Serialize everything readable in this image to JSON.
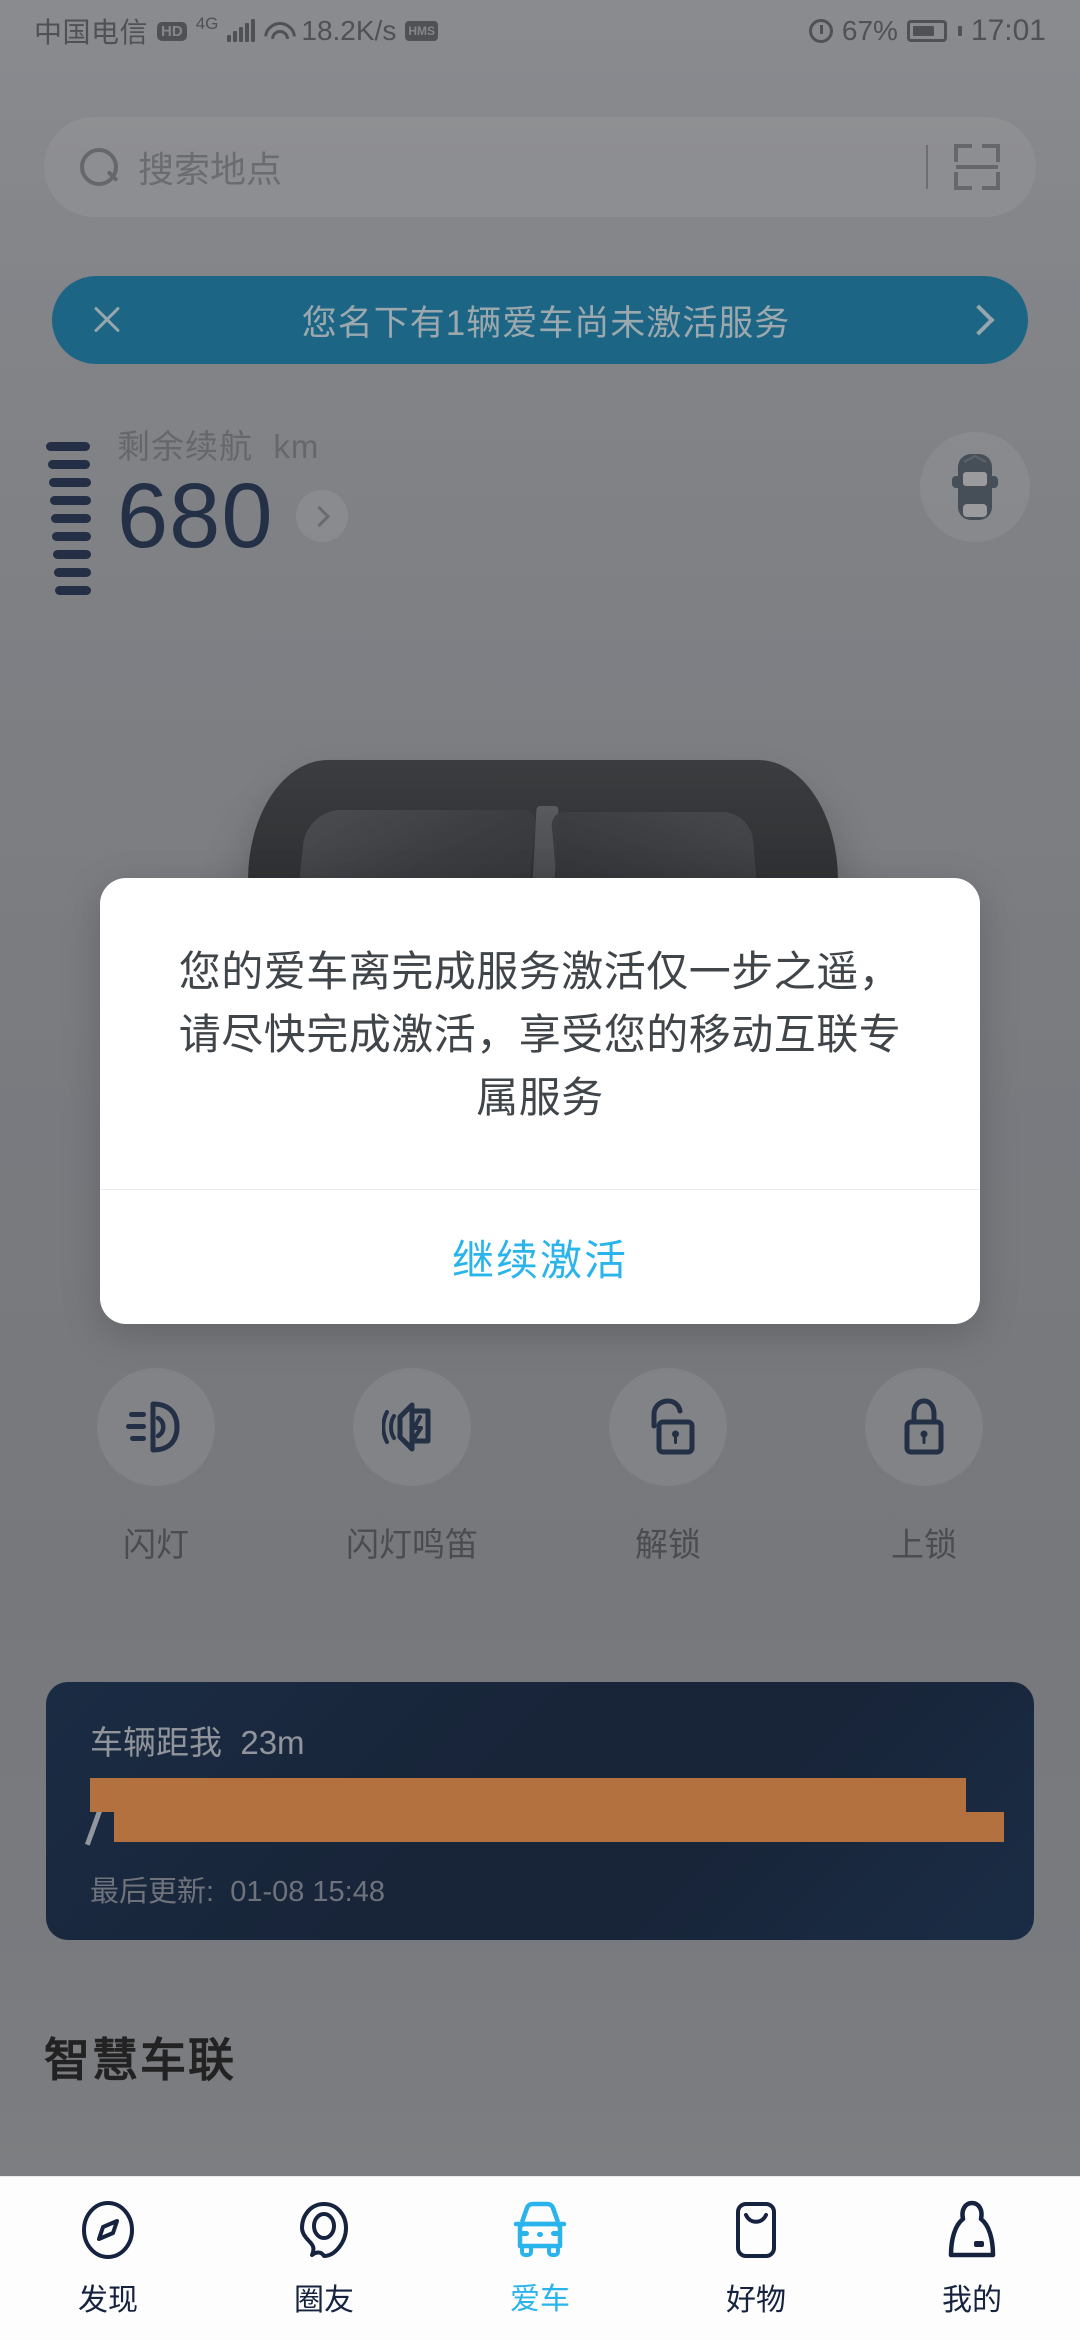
{
  "status_bar": {
    "carrier": "中国电信",
    "hd_badge": "HD",
    "network": "4G",
    "data_rate": "18.2K/s",
    "hms_badge": "HMS",
    "battery_percent": "67%",
    "time": "17:01"
  },
  "search": {
    "placeholder": "搜索地点",
    "search_icon": "search-icon",
    "scan_icon": "scan-code-icon"
  },
  "banner": {
    "text": "您名下有1辆爱车尚未激活服务",
    "close_icon": "close-icon",
    "arrow_icon": "chevron-right-icon",
    "background_color": "#0b7fae"
  },
  "range": {
    "label": "剩余续航",
    "unit": "km",
    "value": "680",
    "value_color": "#15294a",
    "gauge_icon": "fuel-gauge-icon",
    "detail_arrow_icon": "chevron-right-icon",
    "car_top_icon": "car-top-view-icon"
  },
  "actions": [
    {
      "label": "闪灯",
      "icon": "headlight-flash-icon"
    },
    {
      "label": "闪灯鸣笛",
      "icon": "horn-flash-icon"
    },
    {
      "label": "解锁",
      "icon": "unlock-icon"
    },
    {
      "label": "上锁",
      "icon": "lock-icon"
    }
  ],
  "location_card": {
    "distance_label": "车辆距我",
    "distance_value": "23m",
    "address_redacted": "",
    "updated_label": "最后更新:",
    "updated_time": "01-08 15:48",
    "card_color": "#03183a",
    "redaction_color": "#fb9240"
  },
  "section": {
    "title": "智慧车联"
  },
  "dialog": {
    "message": "您的爱车离完成服务激活仅一步之遥，请尽快完成激活，享受您的移动互联专属服务",
    "confirm_label": "继续激活",
    "confirm_color": "#2ab4ec"
  },
  "bottom_nav": {
    "active_color": "#2ab4ec",
    "items": [
      {
        "label": "发现",
        "icon": "compass-icon"
      },
      {
        "label": "圈友",
        "icon": "community-bubble-icon"
      },
      {
        "label": "爱车",
        "icon": "car-front-icon"
      },
      {
        "label": "好物",
        "icon": "shopping-bag-icon"
      },
      {
        "label": "我的",
        "icon": "profile-person-icon"
      }
    ]
  }
}
